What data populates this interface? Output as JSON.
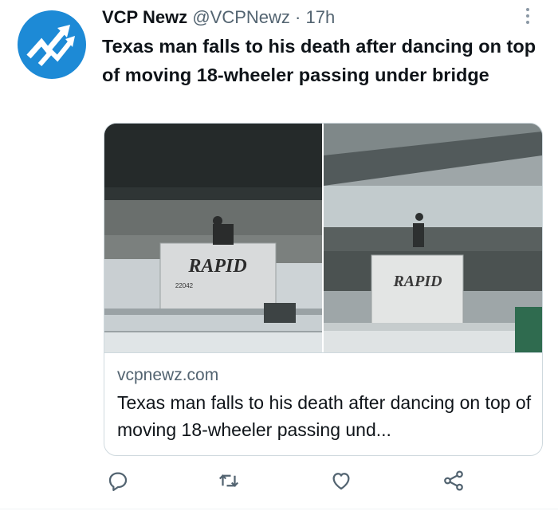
{
  "tweet": {
    "author_name": "VCP Newz",
    "handle": "@VCPNewz",
    "separator": "·",
    "time": "17h",
    "text": "Texas man falls to his death after dancing on top of moving 18-wheeler passing under bridge"
  },
  "card": {
    "domain": "vcpnewz.com",
    "title": "Texas man falls to his death after dancing on top of moving 18-wheeler passing und...",
    "photo_left_truck_label": "RAPID",
    "photo_left_truck_number": "22042",
    "photo_right_truck_label": "RAPID"
  },
  "icons": {
    "avatar": "arrows-logo-icon",
    "more": "more-vertical-icon",
    "reply": "reply-icon",
    "retweet": "retweet-icon",
    "like": "heart-icon",
    "share": "share-icon"
  },
  "colors": {
    "avatar_bg": "#1d8ad6",
    "secondary_text": "#536471",
    "primary_text": "#0f1419",
    "icon": "#536471"
  }
}
